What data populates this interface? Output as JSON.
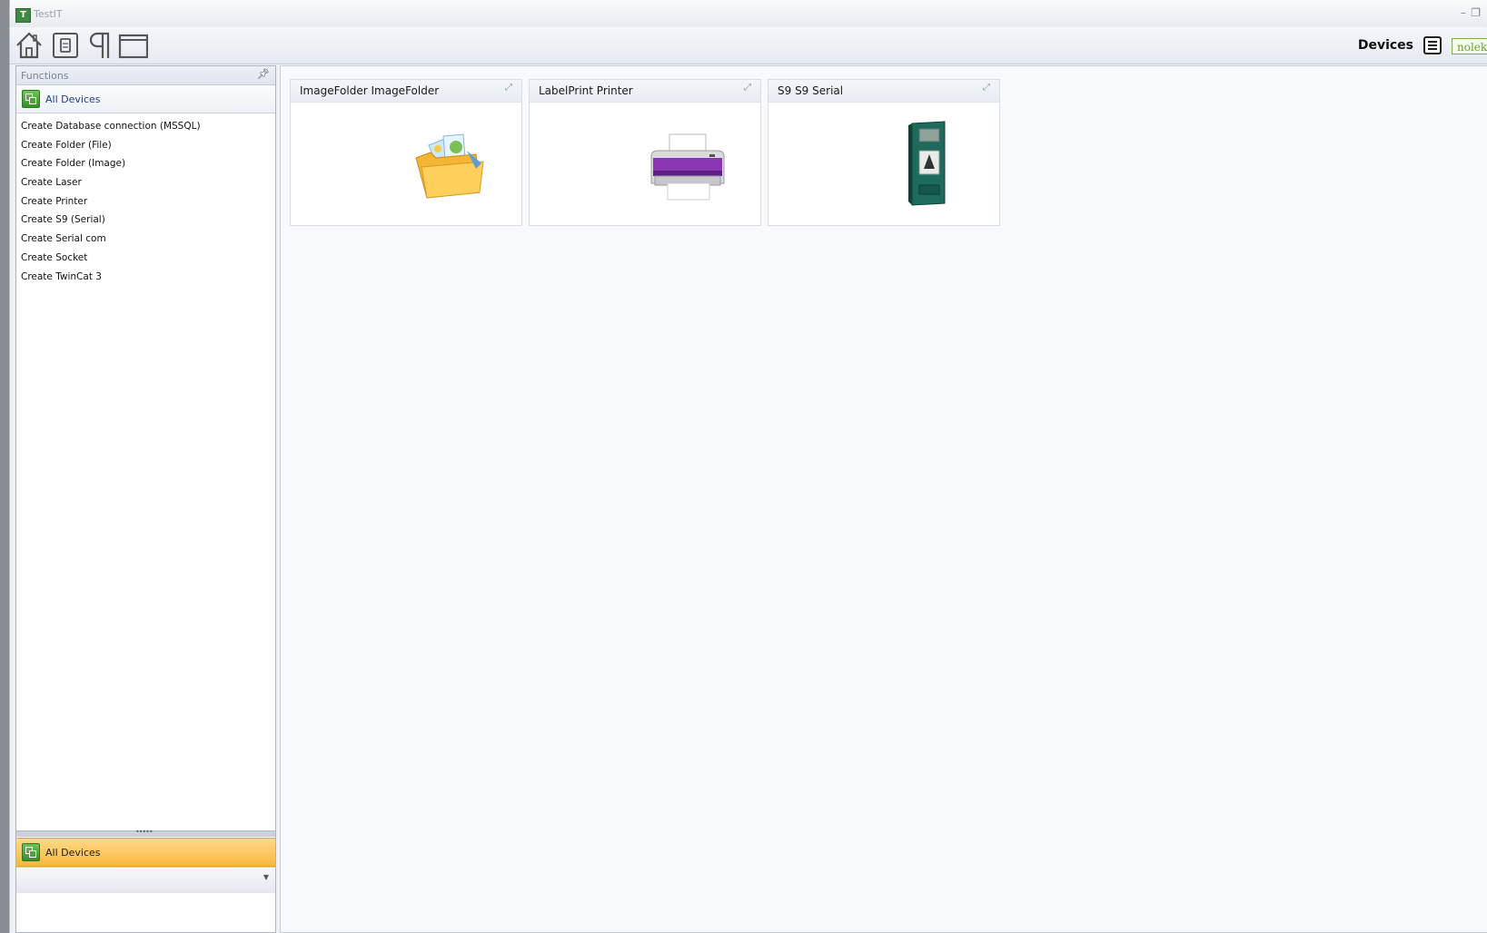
{
  "window": {
    "title": "TestIT"
  },
  "toolbar": {
    "buttons": [
      {
        "name": "home",
        "icon": "home-icon"
      },
      {
        "name": "device",
        "icon": "device-icon"
      },
      {
        "name": "paragraph",
        "icon": "paragraph-icon"
      },
      {
        "name": "window",
        "icon": "window-icon"
      }
    ],
    "section_label": "Devices",
    "brand_text": "nolek"
  },
  "functions_panel": {
    "title": "Functions",
    "group_label": "All Devices",
    "items": [
      "Create Database connection (MSSQL)",
      "Create Folder (File)",
      "Create Folder (Image)",
      "Create Laser",
      "Create Printer",
      "Create S9 (Serial)",
      "Create Serial com",
      "Create Socket",
      "Create TwinCat 3"
    ],
    "active_group_label": "All Devices"
  },
  "devices": [
    {
      "title": "ImageFolder ImageFolder",
      "icon": "image-folder-icon"
    },
    {
      "title": "LabelPrint Printer",
      "icon": "printer-icon"
    },
    {
      "title": "S9 S9 Serial",
      "icon": "serial-device-icon"
    }
  ],
  "colors": {
    "accent_orange": "#f9b73d",
    "accent_green": "#3a8d2d",
    "link_blue": "#1f3f8a",
    "printer_purple": "#7a2aa0",
    "device_teal": "#1e6b5e"
  }
}
